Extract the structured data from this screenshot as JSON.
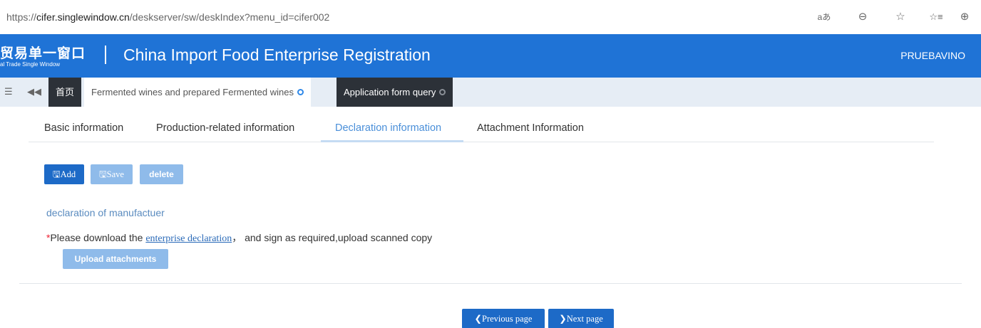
{
  "browser": {
    "url_prefix": "https://",
    "url_domain": "cifer.singlewindow.cn",
    "url_path": "/deskserver/sw/deskIndex?menu_id=cifer002",
    "icons": [
      "read-aloud-icon",
      "zoom-icon",
      "favorite-add-icon",
      "favorites-icon",
      "collections-icon"
    ],
    "icon_glyphs": [
      "aあ",
      "⊖",
      "☆",
      "☆≡",
      "⊕"
    ]
  },
  "header": {
    "logo_cn": "贸易单一窗口",
    "logo_en": "al Trade Single Window",
    "title": "China Import Food Enterprise Registration",
    "user": "PRUEBAVINO",
    "bg_color": "#1f73d6"
  },
  "tabstrip": {
    "menu_glyph": "☰",
    "back_glyph": "◀◀",
    "tabs": [
      {
        "label": "首页"
      },
      {
        "label": "Fermented wines and prepared Fermented wines"
      },
      {
        "label": "Application form query"
      }
    ]
  },
  "subtabs": {
    "items": [
      {
        "label": "Basic information"
      },
      {
        "label": "Production-related information"
      },
      {
        "label": "Declaration information",
        "active": true
      },
      {
        "label": "Attachment Information"
      }
    ]
  },
  "toolbar": {
    "add_label": "Add",
    "save_label": "Save",
    "delete_label": "delete",
    "icon_glyph": "🖫"
  },
  "declaration": {
    "section_title": "declaration of manufactuer",
    "notice_star": "*",
    "notice_before": "Please download the ",
    "notice_link": "enterprise declaration",
    "notice_after": "，  and sign as required,upload scanned copy",
    "upload_label": "Upload attachments"
  },
  "footer": {
    "prev_label": "Previous page",
    "next_label": "Next page",
    "prev_glyph": "❮",
    "next_glyph": "❯"
  },
  "colors": {
    "primary_button": "#1d6ac7",
    "light_button": "#8fbbea",
    "active_tab_text": "#4a8fd9"
  }
}
